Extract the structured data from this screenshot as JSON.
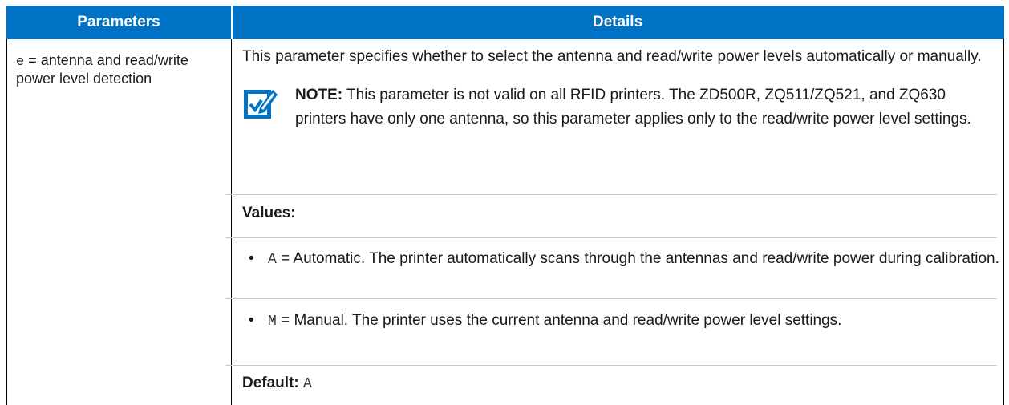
{
  "header": {
    "parameters": "Parameters",
    "details": "Details"
  },
  "param": {
    "code": "e",
    "text": "= antenna and read/write power level detection"
  },
  "details": {
    "intro": "This parameter specifies whether to select the antenna and read/write power levels automatically or manually.",
    "note_label": "NOTE:",
    "note_text": "This parameter is not valid on all RFID printers. The ZD500R, ZQ511/ZQ521, and ZQ630 printers have only one antenna, so this parameter applies only to the read/write power level settings.",
    "note_icon": "note-pencil-icon",
    "values_label": "Values:",
    "bullet_glyph": "•",
    "values": [
      {
        "code": "A",
        "text": "= Automatic. The printer automatically scans through the antennas and read/write power during calibration."
      },
      {
        "code": "M",
        "text": "= Manual. The printer uses the current antenna and read/write power level settings."
      }
    ],
    "default_label": "Default:",
    "default_value": "A"
  },
  "colors": {
    "header_bg": "#0073c6",
    "header_text": "#ffffff",
    "icon": "#0073c6",
    "rule": "#c9c9c9"
  }
}
